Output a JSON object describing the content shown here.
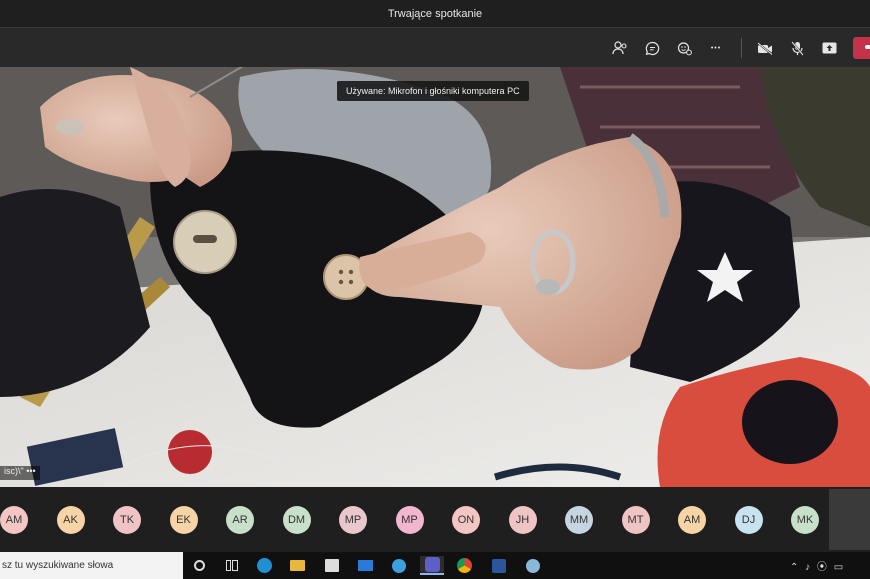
{
  "window": {
    "title": "Trwające spotkanie"
  },
  "toolbar": {
    "icons": [
      "participants-icon",
      "chat-icon",
      "reactions-icon",
      "more-icon",
      "camera-off-icon",
      "mic-off-icon",
      "share-screen-icon",
      "leave-call-icon"
    ],
    "more_glyph": "•••"
  },
  "video": {
    "device_tooltip": "Używane: Mikrofon i głośniki komputera PC",
    "speaker_label": "isc)\\\"  •••"
  },
  "participants": [
    {
      "initials": "AM",
      "color": "#f4c6c3"
    },
    {
      "initials": "AK",
      "color": "#f7d4a6"
    },
    {
      "initials": "TK",
      "color": "#f0c3c5"
    },
    {
      "initials": "EK",
      "color": "#f7d4a6"
    },
    {
      "initials": "AR",
      "color": "#c8e0c9"
    },
    {
      "initials": "DM",
      "color": "#c8e0c9"
    },
    {
      "initials": "MP",
      "color": "#e8c8cc"
    },
    {
      "initials": "MP",
      "color": "#f2b6d1"
    },
    {
      "initials": "ON",
      "color": "#f4c6c3"
    },
    {
      "initials": "JH",
      "color": "#f0c3c5"
    },
    {
      "initials": "MM",
      "color": "#c6d5e2"
    },
    {
      "initials": "MT",
      "color": "#f0c3c5"
    },
    {
      "initials": "AM",
      "color": "#f7d4a6"
    },
    {
      "initials": "DJ",
      "color": "#c8e3ef"
    },
    {
      "initials": "MK",
      "color": "#c8e0c9"
    }
  ],
  "taskbar": {
    "search_placeholder": "sz tu wyszukiwane słowa",
    "icons": [
      "cortana-icon",
      "task-view-icon",
      "edge-icon",
      "file-explorer-icon",
      "store-icon",
      "mail-icon",
      "clipchamp-icon",
      "teams-icon",
      "chrome-icon",
      "word-icon",
      "paint-icon"
    ],
    "tray": "⌃ ♪ ⦿ ▭"
  },
  "colors": {
    "leave_button": "#c4314b",
    "title_bar": "#1f1f1f",
    "toolbar": "#292929"
  }
}
